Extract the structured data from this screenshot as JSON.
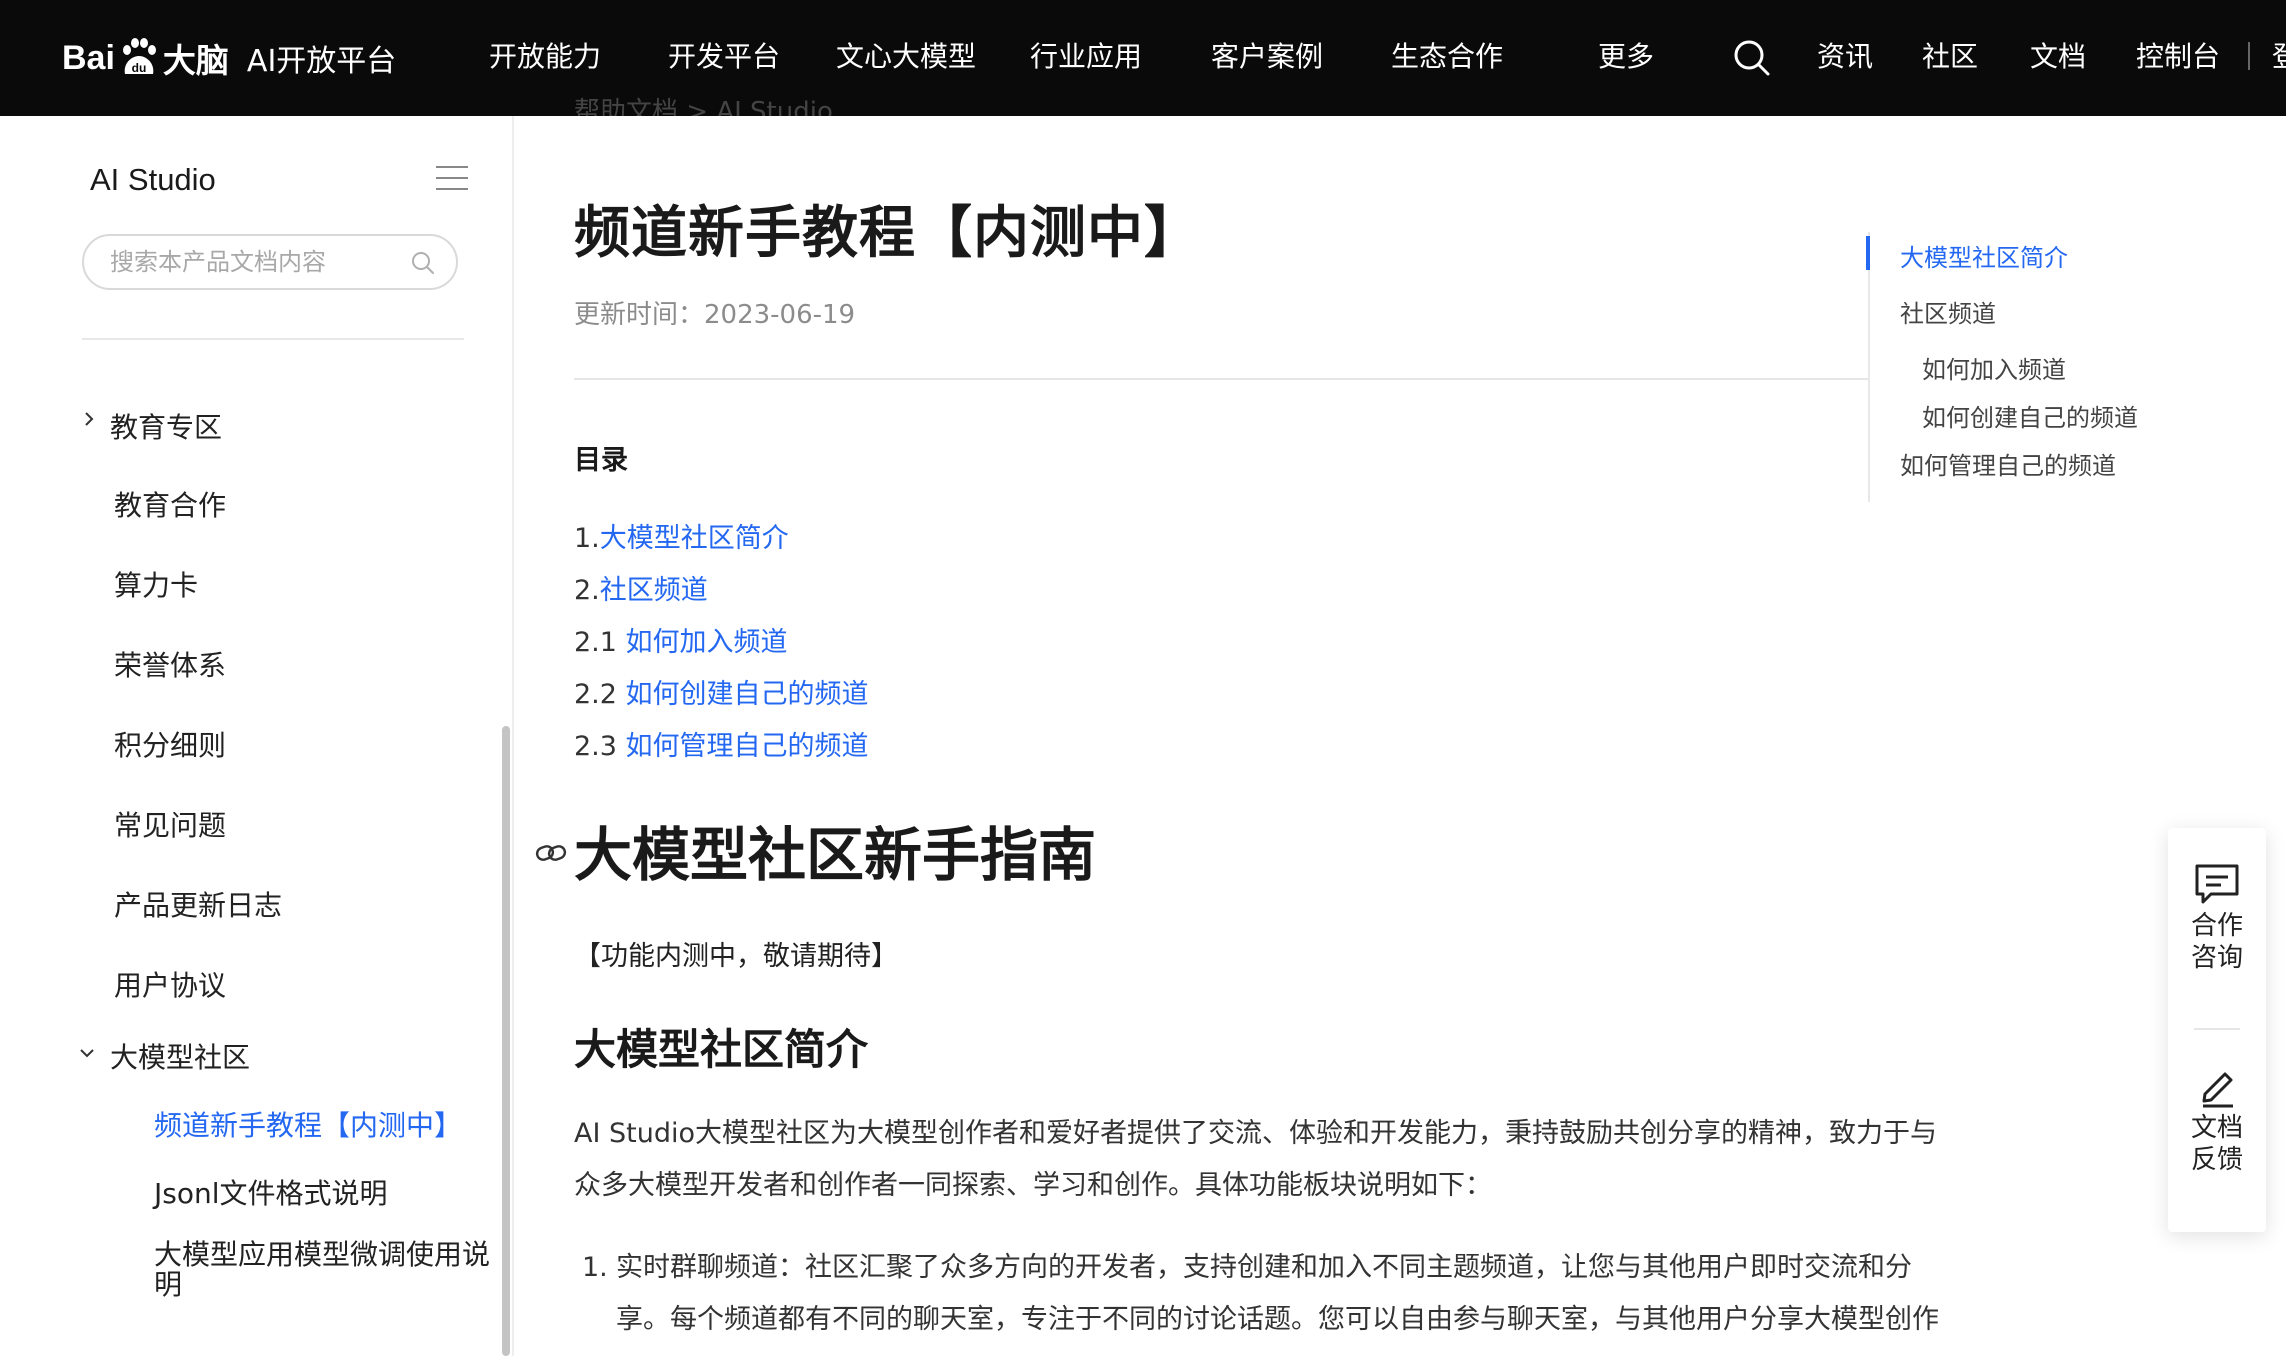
{
  "header": {
    "logo_text_bai": "Bai",
    "logo_text_da": "大脑",
    "platform": "AI开放平台",
    "nav": [
      "开放能力",
      "开发平台",
      "文心大模型",
      "行业应用",
      "客户案例",
      "生态合作",
      "更多"
    ],
    "right_links": [
      "资讯",
      "社区",
      "文档",
      "控制台"
    ],
    "cut_text": "登"
  },
  "sidebar": {
    "title": "AI Studio",
    "search_placeholder": "搜索本产品文档内容",
    "items": [
      {
        "label": "教育专区",
        "type": "group-collapsed"
      },
      {
        "label": "教育合作"
      },
      {
        "label": "算力卡"
      },
      {
        "label": "荣誉体系"
      },
      {
        "label": "积分细则"
      },
      {
        "label": "常见问题"
      },
      {
        "label": "产品更新日志"
      },
      {
        "label": "用户协议"
      },
      {
        "label": "大模型社区",
        "type": "group-expanded"
      },
      {
        "label": "频道新手教程【内测中】",
        "active": true
      },
      {
        "label": "Jsonl文件格式说明"
      },
      {
        "label": "大模型应用模型微调使用说明"
      }
    ]
  },
  "breadcrumb": "帮助文档 > AI Studio",
  "main": {
    "title": "频道新手教程【内测中】",
    "update_time": "更新时间：2023-06-19",
    "toc_label": "目录",
    "toc": [
      {
        "prefix": "1.",
        "link": "大模型社区简介"
      },
      {
        "prefix": "2.",
        "link": "社区频道"
      },
      {
        "prefix": "2.1 ",
        "link": "如何加入频道"
      },
      {
        "prefix": "2.2 ",
        "link": "如何创建自己的频道"
      },
      {
        "prefix": "2.3 ",
        "link": "如何管理自己的频道"
      }
    ],
    "section_title": "大模型社区新手指南",
    "notice": "【功能内测中，敬请期待】",
    "sub_title": "大模型社区简介",
    "paragraph_line1": "AI Studio大模型社区为大模型创作者和爱好者提供了交流、体验和开发能力，秉持鼓励共创分享的精神，致力于与",
    "paragraph_line2": "众多大模型开发者和创作者一同探索、学习和创作。具体功能板块说明如下：",
    "list_num": "1.",
    "list_line1": "实时群聊频道：社区汇聚了众多方向的开发者，支持创建和加入不同主题频道，让您与其他用户即时交流和分",
    "list_line2": "享。每个频道都有不同的聊天室，专注于不同的讨论话题。您可以自由参与聊天室，与其他用户分享大模型创作"
  },
  "right_toc": [
    {
      "label": "大模型社区简介",
      "active": true,
      "level": 1
    },
    {
      "label": "社区频道",
      "level": 1
    },
    {
      "label": "如何加入频道",
      "level": 2
    },
    {
      "label": "如何创建自己的频道",
      "level": 2
    },
    {
      "label": "如何管理自己的频道",
      "level": 1
    }
  ],
  "float": {
    "consult_line1": "合作",
    "consult_line2": "咨询",
    "feedback_line1": "文档",
    "feedback_line2": "反馈"
  },
  "colors": {
    "accent": "#2468f2",
    "nav_bg": "#0a0a0a"
  }
}
